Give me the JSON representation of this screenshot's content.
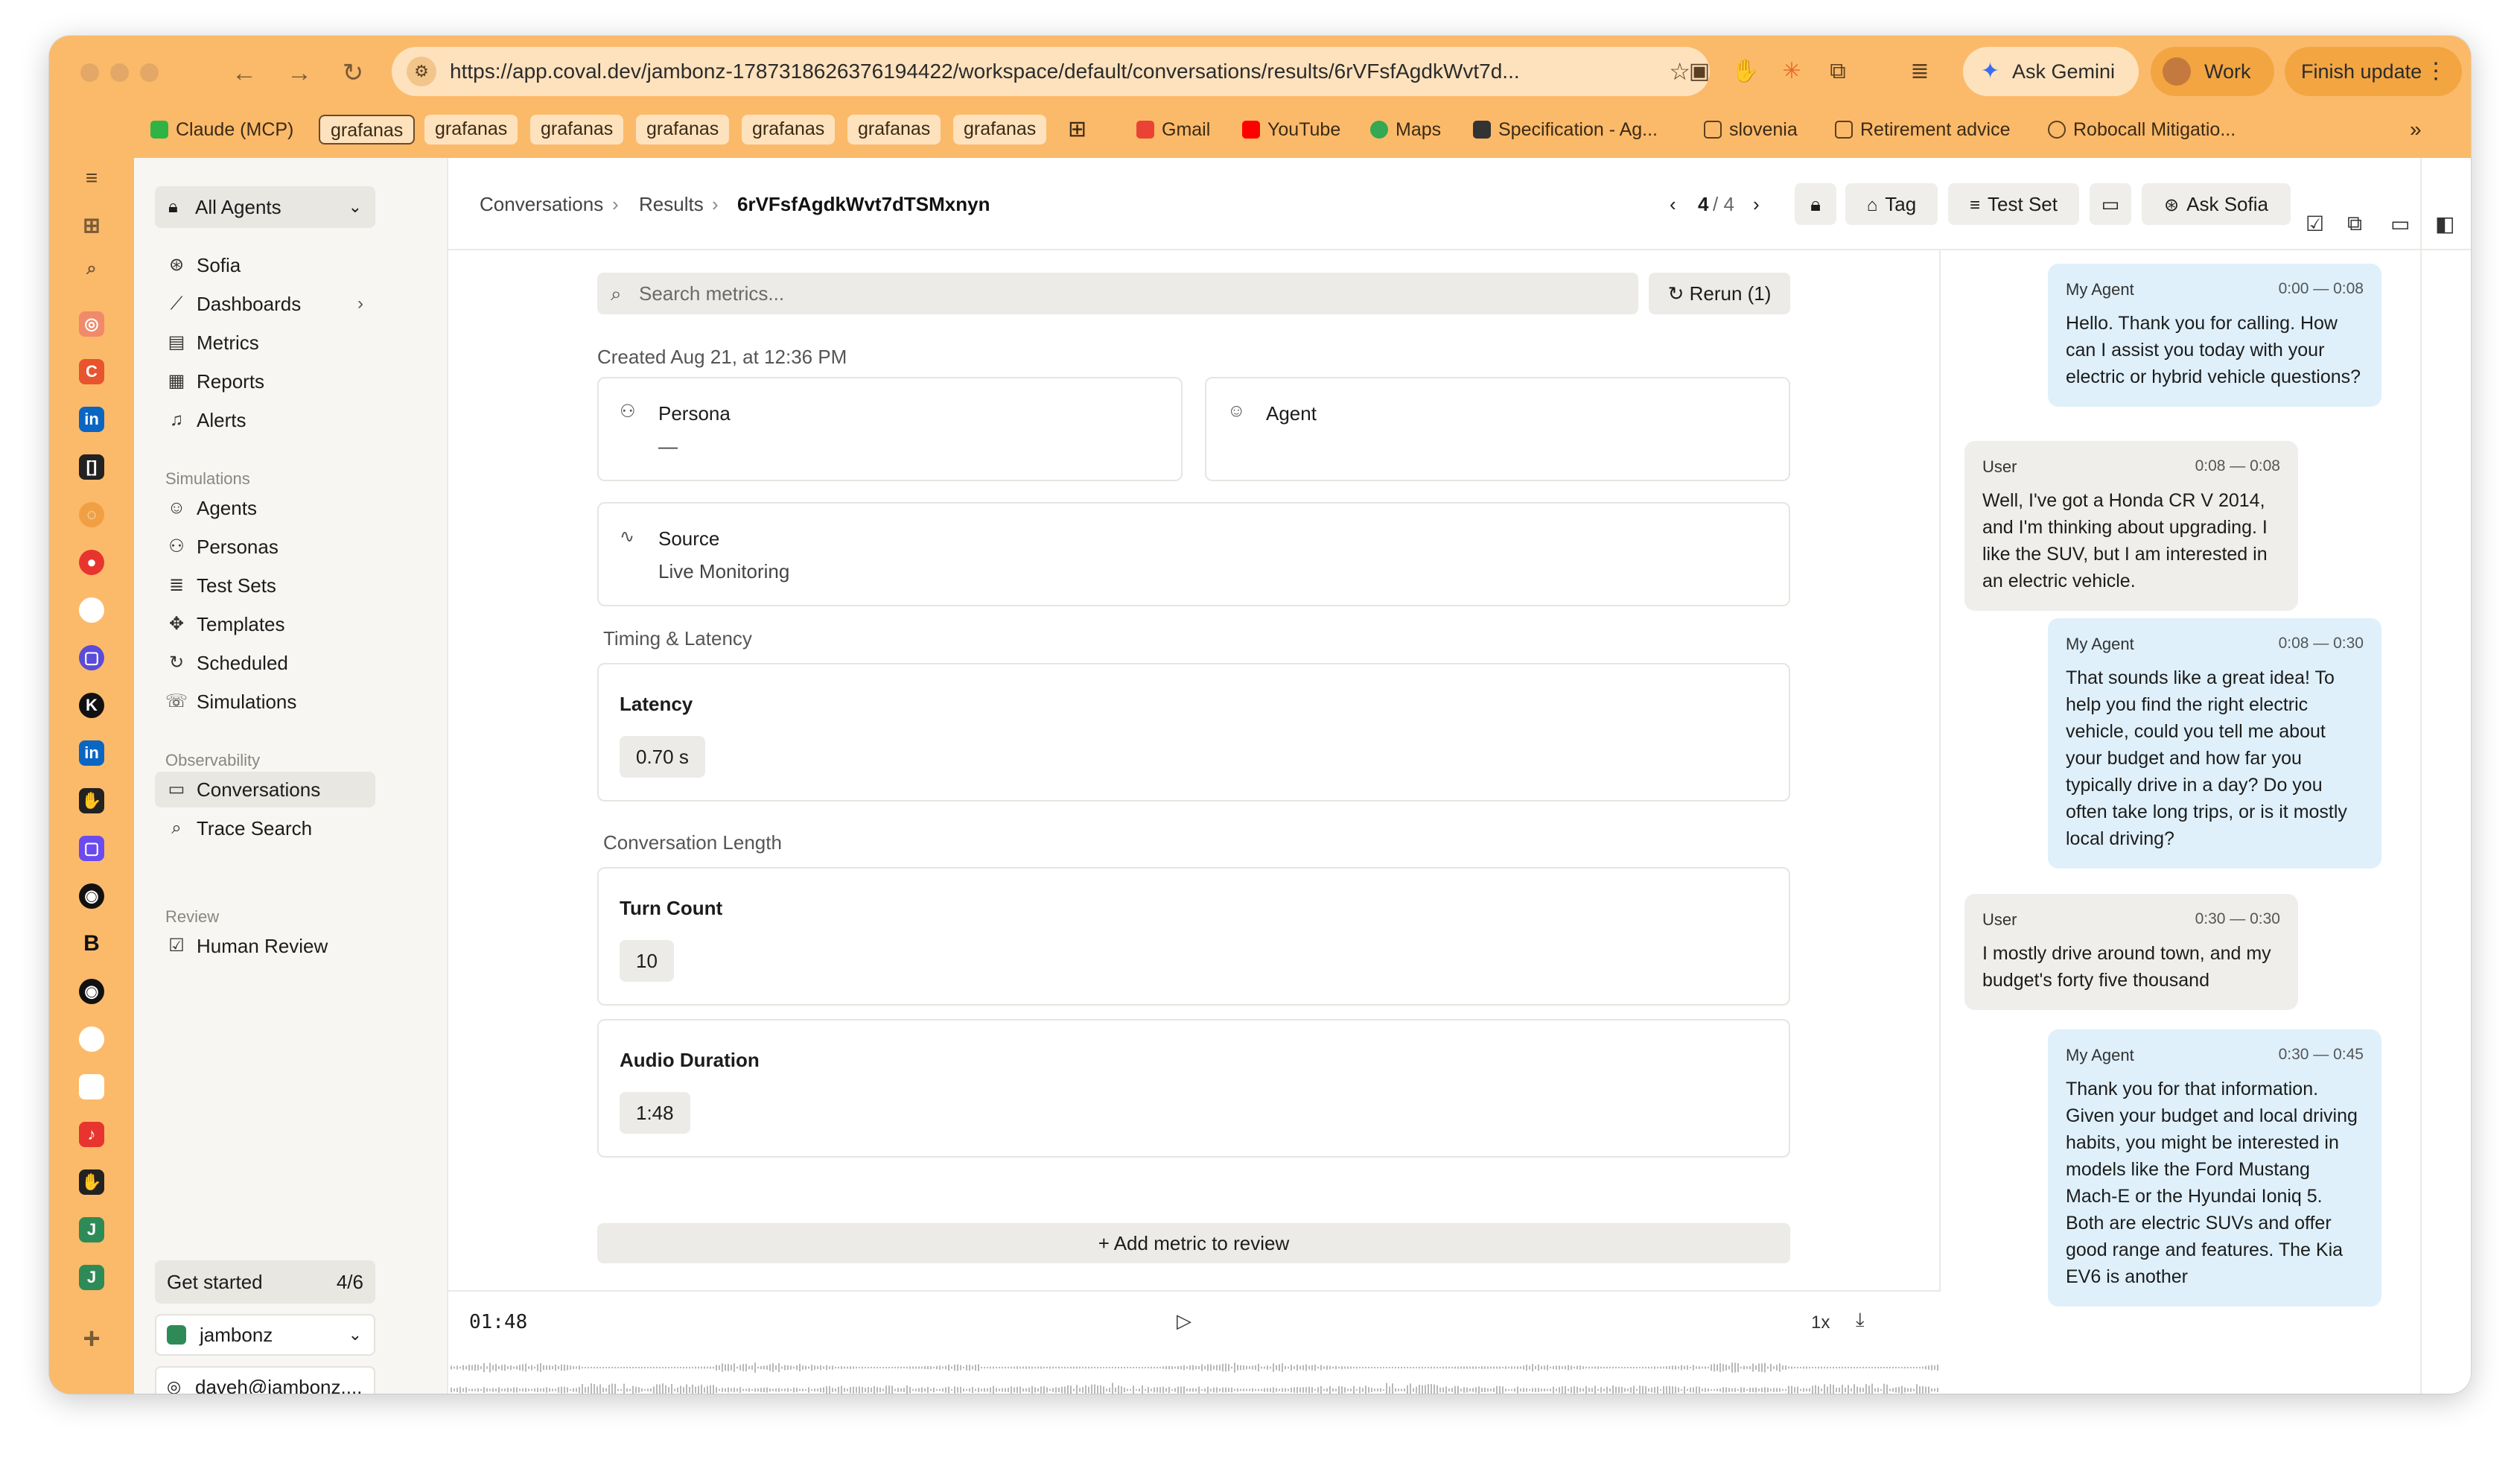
{
  "browser": {
    "url": "https://app.coval.dev/jambonz-1787318626376194422/workspace/default/conversations/results/6rVFsfAgdkWvt7d...",
    "ask_gemini": "Ask Gemini",
    "profile": "Work",
    "finish_update": "Finish update",
    "bookmarks": [
      {
        "label": "Claude (MCP)"
      },
      {
        "label": "grafanas",
        "active": true
      },
      {
        "label": "grafanas"
      },
      {
        "label": "grafanas"
      },
      {
        "label": "grafanas"
      },
      {
        "label": "grafanas"
      },
      {
        "label": "grafanas"
      },
      {
        "label": "grafanas"
      },
      {
        "label": "Gmail"
      },
      {
        "label": "YouTube"
      },
      {
        "label": "Maps"
      },
      {
        "label": "Specification - Ag..."
      },
      {
        "label": "slovenia"
      },
      {
        "label": "Retirement advice"
      },
      {
        "label": "Robocall Mitigatio..."
      }
    ]
  },
  "sidebar": {
    "agent_selector": "All Agents",
    "items": [
      {
        "label": "Sofia",
        "icon": "sofia-icon"
      },
      {
        "label": "Dashboards",
        "icon": "chart-icon"
      },
      {
        "label": "Metrics",
        "icon": "metrics-icon"
      },
      {
        "label": "Reports",
        "icon": "report-icon"
      },
      {
        "label": "Alerts",
        "icon": "bell-icon"
      }
    ],
    "simulations_title": "Simulations",
    "simulations": [
      {
        "label": "Agents"
      },
      {
        "label": "Personas"
      },
      {
        "label": "Test Sets"
      },
      {
        "label": "Templates"
      },
      {
        "label": "Scheduled"
      },
      {
        "label": "Simulations"
      }
    ],
    "observability_title": "Observability",
    "observability": [
      {
        "label": "Conversations"
      },
      {
        "label": "Trace Search"
      }
    ],
    "review_title": "Review",
    "review": [
      {
        "label": "Human Review"
      }
    ],
    "get_started": "Get started",
    "get_started_count": "4/6",
    "workspace": "jambonz",
    "user": "daveh@jambonz...."
  },
  "header": {
    "breadcrumb": [
      "Conversations",
      "Results",
      "6rVFsfAgdkWvt7dTSMxnyn"
    ],
    "pager_current": "4",
    "pager_total": "/ 4",
    "tag": "Tag",
    "test_set": "Test Set",
    "ask_sofia": "Ask Sofia"
  },
  "main": {
    "search_placeholder": "Search metrics...",
    "rerun": "Rerun (1)",
    "created": "Created Aug 21, at 12:36 PM",
    "persona_label": "Persona",
    "persona_value": "—",
    "agent_label": "Agent",
    "source_label": "Source",
    "source_value": "Live Monitoring",
    "timing_section": "Timing & Latency",
    "latency_title": "Latency",
    "latency_value": "0.70 s",
    "length_section": "Conversation Length",
    "turn_count_title": "Turn Count",
    "turn_count_value": "10",
    "audio_duration_title": "Audio Duration",
    "audio_duration_value": "1:48",
    "add_metric": "Add metric to review"
  },
  "player": {
    "time": "01:48",
    "speed": "1x"
  },
  "transcript": [
    {
      "speaker": "My Agent",
      "time": "0:00 — 0:08",
      "text": "Hello. Thank you for calling. How can I assist you today with your electric or hybrid vehicle questions?"
    },
    {
      "speaker": "User",
      "time": "0:08 — 0:08",
      "text": "Well, I've got a Honda CR V 2014, and I'm thinking about upgrading. I like the SUV, but I am interested in an electric vehicle."
    },
    {
      "speaker": "My Agent",
      "time": "0:08 — 0:30",
      "text": "That sounds like a great idea! To help you find the right electric vehicle, could you tell me about your budget and how far you typically drive in a day? Do you often take long trips, or is it mostly local driving?"
    },
    {
      "speaker": "User",
      "time": "0:30 — 0:30",
      "text": "I mostly drive around town, and my budget's forty five thousand"
    },
    {
      "speaker": "My Agent",
      "time": "0:30 — 0:45",
      "text": "Thank you for that information. Given your budget and local driving habits, you might be interested in models like the Ford Mustang Mach-E or the Hyundai Ioniq 5. Both are electric SUVs and offer good range and features. The Kia EV6 is another"
    }
  ]
}
